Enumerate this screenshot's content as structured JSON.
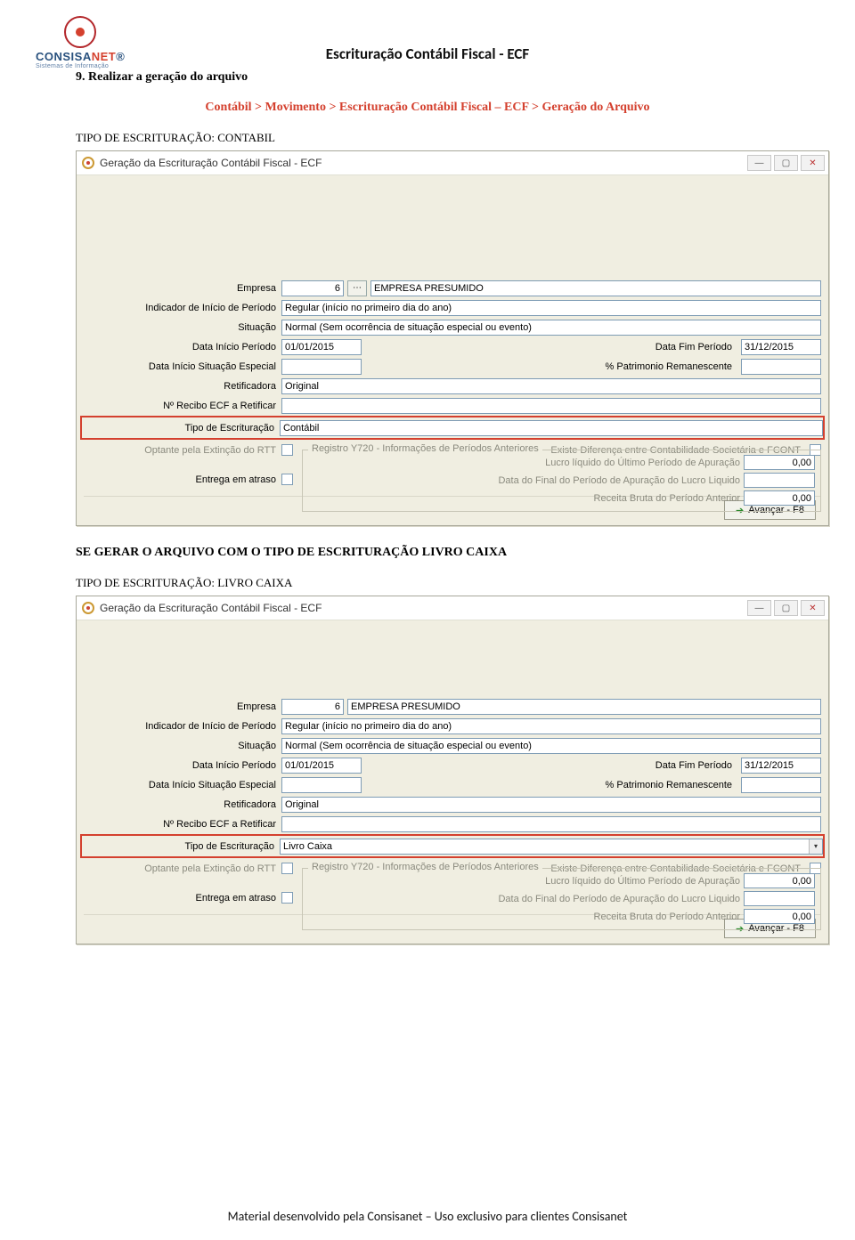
{
  "logo": {
    "brand_a": "CONSISA",
    "brand_b": "NET",
    "sub": "Sistemas de Informação",
    "reg": "®"
  },
  "header_title": "Escrituração Contábil Fiscal - ECF",
  "section_num": "9. Realizar a geração do arquivo",
  "breadcrumb": "Contábil > Movimento > Escrituração Contábil Fiscal – ECF > Geração do Arquivo",
  "tipo1_label": "TIPO DE ESCRITURAÇÃO: CONTABIL",
  "heading2": "SE GERAR O ARQUIVO COM O TIPO DE ESCRITURAÇÃO LIVRO CAIXA",
  "tipo2_label": "TIPO DE ESCRITURAÇÃO: LIVRO CAIXA",
  "labels": {
    "empresa": "Empresa",
    "indicador": "Indicador de Início de Período",
    "situacao": "Situação",
    "data_inicio": "Data Início Período",
    "data_fim": "Data Fim Período",
    "data_sit": "Data Início Situação Especial",
    "pct_patr": "% Patrimonio Remanescente",
    "retificadora": "Retificadora",
    "num_recibo": "Nº Recibo ECF a Retificar",
    "tipo_esc": "Tipo de Escrituração",
    "optante": "Optante pela Extinção do RTT",
    "diferenca": "Existe Diferença entre Contabilidade Societária e FCONT",
    "entrega": "Entrega em atraso",
    "group": "Registro Y720 - Informações de Períodos Anteriores",
    "lucro_liq": "Lucro líquido do Último Período de Apuração",
    "data_final_ap": "Data do Final do Período de Apuração do Lucro Liquido",
    "receita_bruta": "Receita Bruta do Período Anterior",
    "avancar": "Avançar - F8"
  },
  "win1": {
    "title": "Geração da Escrituração Contábil Fiscal - ECF",
    "empresa_cod": "6",
    "empresa_nome": "EMPRESA PRESUMIDO",
    "indicador": "Regular (início no primeiro dia do ano)",
    "situacao": "Normal (Sem ocorrência de situação especial ou evento)",
    "data_inicio": "01/01/2015",
    "data_fim": "31/12/2015",
    "data_sit": "",
    "pct_patr": "",
    "retificadora": "Original",
    "num_recibo": "",
    "tipo_esc": "Contábil",
    "lucro_liq": "0,00",
    "data_final_ap": "",
    "receita_bruta": "0,00"
  },
  "win2": {
    "title": "Geração da Escrituração Contábil Fiscal - ECF",
    "empresa_cod": "6",
    "empresa_nome": "EMPRESA PRESUMIDO",
    "indicador": "Regular (início no primeiro dia do ano)",
    "situacao": "Normal (Sem ocorrência de situação especial ou evento)",
    "data_inicio": "01/01/2015",
    "data_fim": "31/12/2015",
    "data_sit": "",
    "pct_patr": "",
    "retificadora": "Original",
    "num_recibo": "",
    "tipo_esc": "Livro Caixa",
    "lucro_liq": "0,00",
    "data_final_ap": "",
    "receita_bruta": "0,00"
  },
  "footer": "Material desenvolvido pela Consisanet – Uso exclusivo para clientes Consisanet"
}
